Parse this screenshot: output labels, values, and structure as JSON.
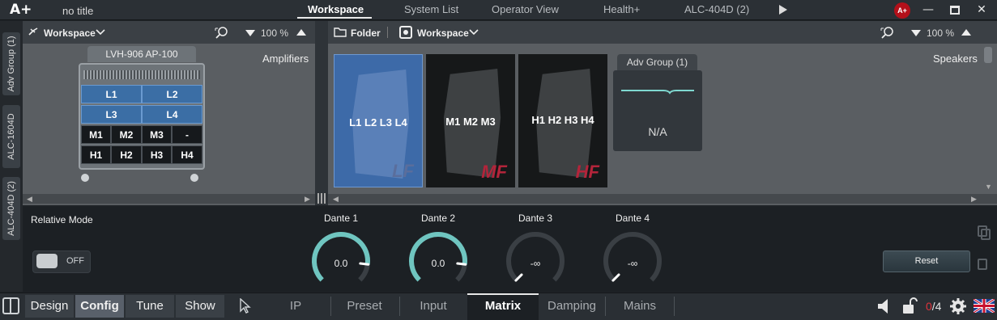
{
  "app": {
    "logo": "A+",
    "doc_title": "no title",
    "tabs": [
      "Workspace",
      "System List",
      "Operator View",
      "Health+",
      "ALC-404D (2)"
    ],
    "user_badge": "A+",
    "window_controls": [
      "minimize-icon",
      "maximize-icon",
      "close-icon"
    ]
  },
  "side_tabs": [
    "Adv Group (1)",
    "ALC-1604D",
    "ALC-404D (2)"
  ],
  "left_panel": {
    "workspace_label": "Workspace",
    "zoom": "100 %",
    "section_label": "Amplifiers",
    "rack": {
      "title": "LVH-906 AP-100",
      "rows": [
        [
          "L1",
          "L2"
        ],
        [
          "L3",
          "L4"
        ],
        [
          "M1",
          "M2",
          "M3",
          "-"
        ],
        [
          "H1",
          "H2",
          "H3",
          "H4"
        ]
      ]
    }
  },
  "right_panel": {
    "folder_label": "Folder",
    "workspace_label": "Workspace",
    "zoom": "100 %",
    "section_label": "Speakers",
    "speakers": [
      {
        "label": "L1 L2 L3 L4",
        "tag": "LF"
      },
      {
        "label": "M1 M2 M3",
        "tag": "MF"
      },
      {
        "label": "H1 H2 H3 H4",
        "tag": "HF"
      }
    ],
    "adv_group": {
      "title": "Adv Group (1)",
      "value": "N/A"
    }
  },
  "controls": {
    "relative_mode_label": "Relative Mode",
    "toggle_state": "OFF",
    "dante": [
      {
        "label": "Dante 1",
        "value": "0.0",
        "level": 0.86
      },
      {
        "label": "Dante 2",
        "value": "0.0",
        "level": 0.86
      },
      {
        "label": "Dante 3",
        "value": "-∞",
        "level": 0
      },
      {
        "label": "Dante 4",
        "value": "-∞",
        "level": 0
      }
    ],
    "reset_label": "Reset"
  },
  "bottom": {
    "modes": [
      "Design",
      "Config",
      "Tune",
      "Show"
    ],
    "active_mode": "Config",
    "tabs": [
      "IP",
      "Preset",
      "Input",
      "Matrix",
      "Damping",
      "Mains"
    ],
    "active_tab": "Matrix",
    "counter_value": "0",
    "counter_total": "/4"
  },
  "colors": {
    "accent_teal": "#7fd8d0",
    "badge_red": "#b3101a",
    "lf": "#5a6e9c",
    "mf": "#b3243a",
    "hf": "#b3243a"
  }
}
